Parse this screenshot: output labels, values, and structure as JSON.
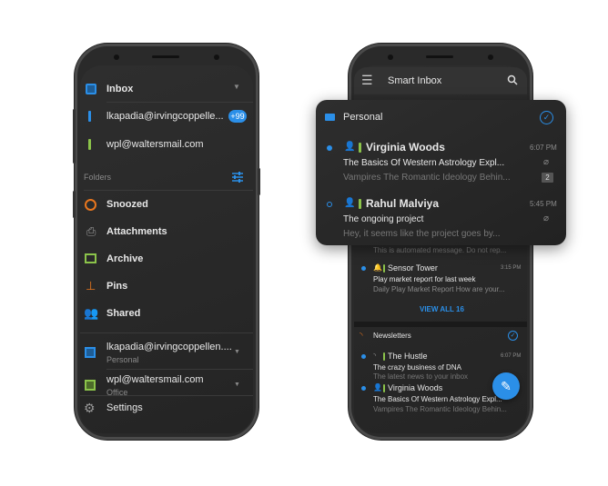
{
  "colors": {
    "accent": "#2b8fe8",
    "green": "#8bc34a",
    "orange": "#e8761e",
    "purple": "#9b3de8"
  },
  "left": {
    "inbox": "Inbox",
    "accounts": [
      {
        "email": "lkapadia@irvingcoppelle...",
        "badge": "+99"
      },
      {
        "email": "wpl@waltersmail.com"
      }
    ],
    "folders_label": "Folders",
    "folders": [
      {
        "label": "Snoozed",
        "icon": "clock-icon"
      },
      {
        "label": "Attachments",
        "icon": "paperclip-icon"
      },
      {
        "label": "Archive",
        "icon": "archive-icon"
      },
      {
        "label": "Pins",
        "icon": "pin-icon"
      },
      {
        "label": "Shared",
        "icon": "people-icon"
      }
    ],
    "mailboxes": [
      {
        "email": "lkapadia@irvingcoppellen....",
        "type": "Personal"
      },
      {
        "email": "wpl@waltersmail.com",
        "type": "Office"
      }
    ],
    "settings": "Settings"
  },
  "right": {
    "title": "Smart Inbox",
    "personal": {
      "label": "Personal",
      "emails": [
        {
          "sender": "Virginia Woods",
          "time": "6:07 PM",
          "subject": "The Basics Of Western Astrology Expl...",
          "preview": "Vampires The Romantic Ideology Behin...",
          "count": "2"
        },
        {
          "sender": "Rahul Malviya",
          "time": "5:45 PM",
          "subject": "The ongoing project",
          "preview": "Hey, it seems like the project goes by..."
        }
      ]
    },
    "behind_preview": "This is automated message. Do not rep...",
    "sensor": {
      "sender": "Sensor Tower",
      "time": "3:15 PM",
      "subject": "Play market report for last week",
      "preview": "Daily Play Market Report How are your..."
    },
    "view_all": "VIEW ALL 16",
    "newsletters": {
      "label": "Newsletters",
      "emails": [
        {
          "sender": "The Hustle",
          "time": "6:07 PM",
          "subject": "The crazy business of DNA",
          "preview": "The latest news to your inbox"
        },
        {
          "sender": "Virginia Woods",
          "subject": "The Basics Of Western Astrology Expl...",
          "preview": "Vampires The Romantic Ideology Behin..."
        }
      ]
    }
  }
}
